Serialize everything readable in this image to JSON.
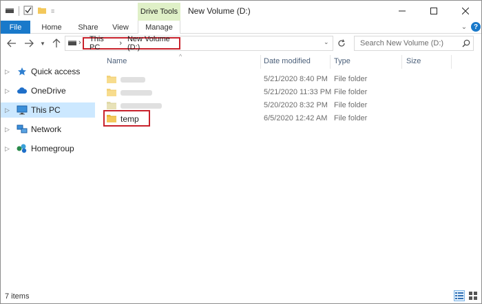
{
  "window": {
    "title": "New Volume (D:)",
    "context_tab_group": "Drive Tools"
  },
  "ribbon": {
    "tabs": [
      "File",
      "Home",
      "Share",
      "View",
      "Manage"
    ]
  },
  "address_bar": {
    "crumbs": [
      "This PC",
      "New Volume (D:)"
    ]
  },
  "search": {
    "placeholder": "Search New Volume (D:)"
  },
  "nav_pane": {
    "items": [
      {
        "label": "Quick access",
        "icon": "star-icon"
      },
      {
        "label": "OneDrive",
        "icon": "cloud-icon"
      },
      {
        "label": "This PC",
        "icon": "computer-icon",
        "selected": true
      },
      {
        "label": "Network",
        "icon": "network-icon"
      },
      {
        "label": "Homegroup",
        "icon": "homegroup-icon"
      }
    ]
  },
  "columns": [
    "Name",
    "Date modified",
    "Type",
    "Size"
  ],
  "files": [
    {
      "name": "",
      "date": "5/21/2020 8:40 PM",
      "type": "File folder",
      "size": ""
    },
    {
      "name": "",
      "date": "5/21/2020 11:33 PM",
      "type": "File folder",
      "size": ""
    },
    {
      "name": "",
      "date": "5/20/2020 8:32 PM",
      "type": "File folder",
      "size": ""
    },
    {
      "name": "temp",
      "date": "6/5/2020 12:42 AM",
      "type": "File folder",
      "size": ""
    }
  ],
  "status": {
    "item_count": "7 items"
  },
  "colors": {
    "accent": "#1979ca",
    "context_tab": "#dff0c7",
    "selection": "#cce8ff",
    "highlight_box": "#c8202a",
    "folder": "#f3c85b"
  }
}
